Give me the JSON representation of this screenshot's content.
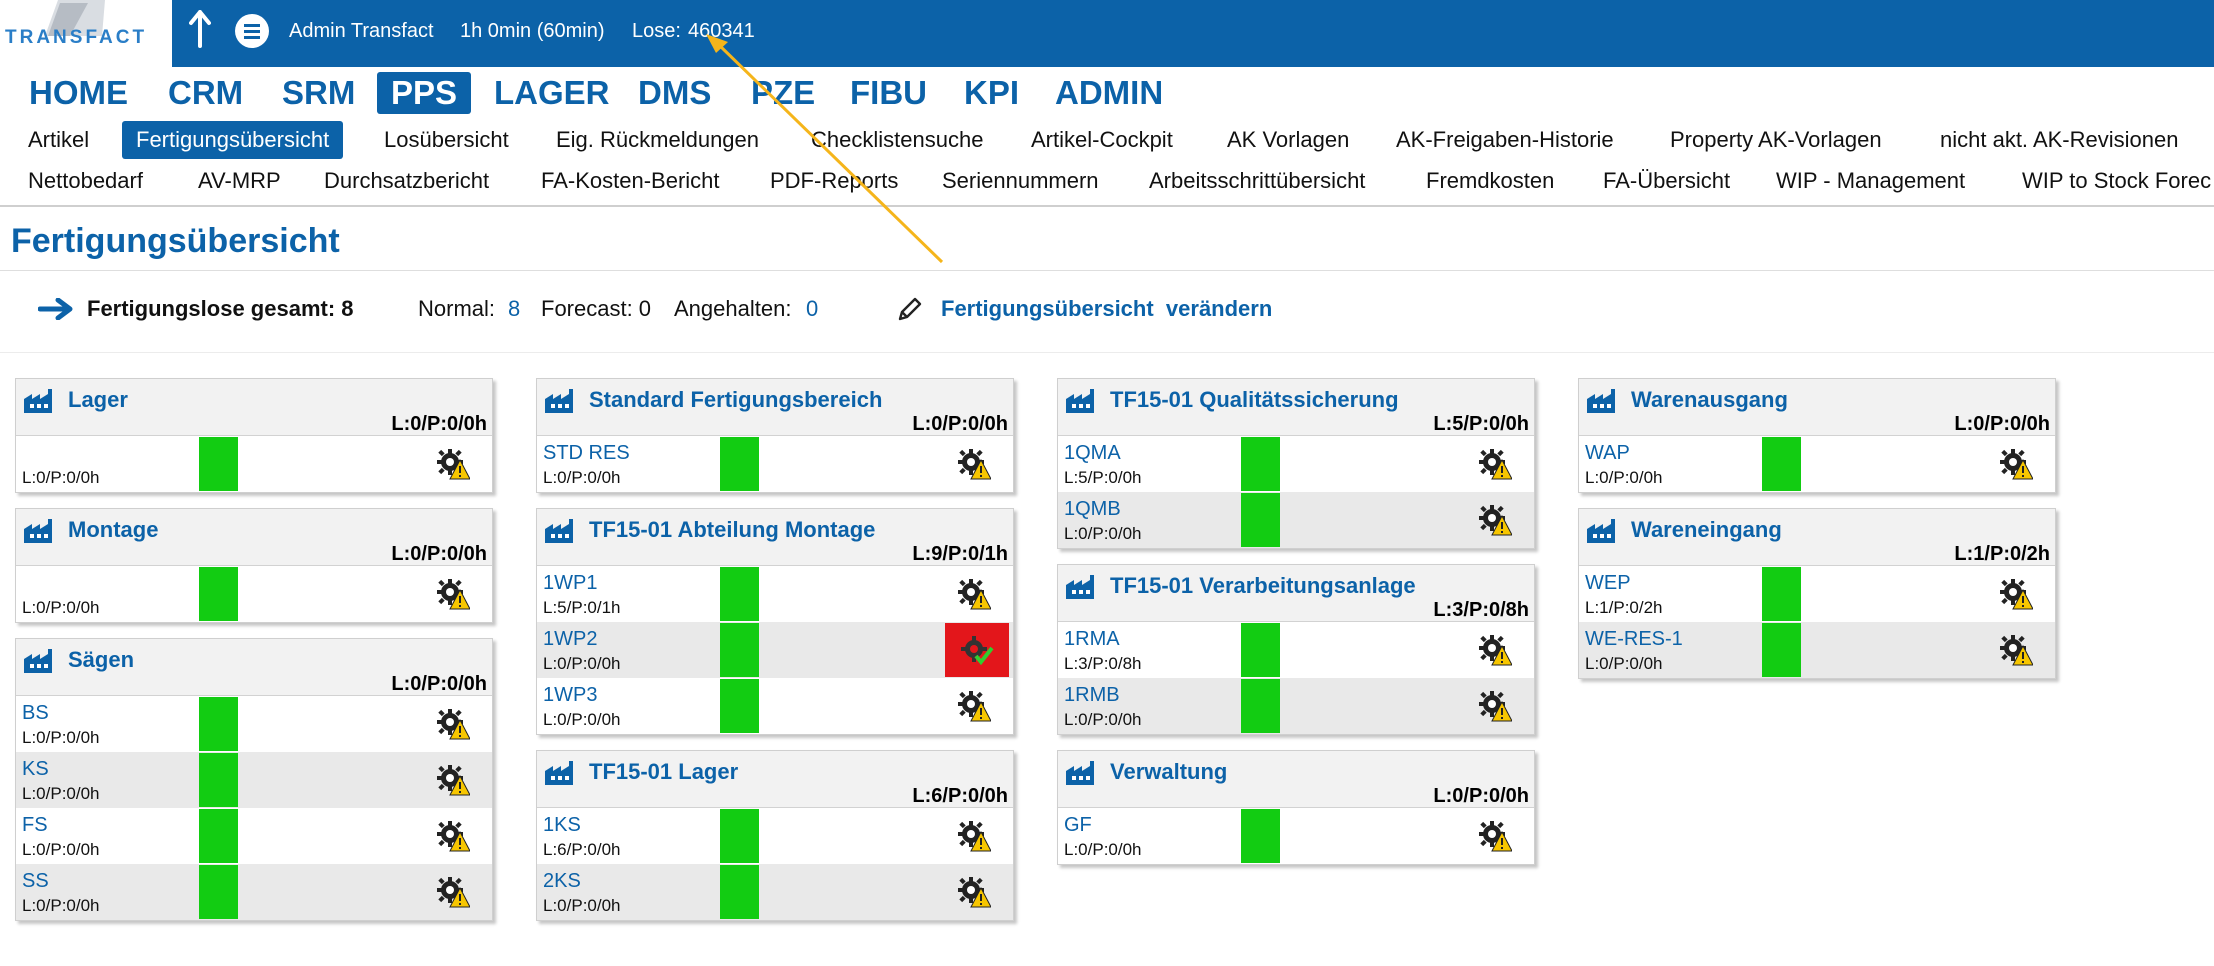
{
  "header": {
    "logo_text": "TRANSFACT",
    "user": "Admin Transfact",
    "session": "1h 0min (60min)",
    "lose_label": "Lose:",
    "lose_value": "460341"
  },
  "main_nav": [
    {
      "label": "HOME",
      "active": false
    },
    {
      "label": "CRM",
      "active": false
    },
    {
      "label": "SRM",
      "active": false
    },
    {
      "label": "PPS",
      "active": true
    },
    {
      "label": "LAGER",
      "active": false
    },
    {
      "label": "DMS",
      "active": false
    },
    {
      "label": "PZE",
      "active": false
    },
    {
      "label": "FIBU",
      "active": false
    },
    {
      "label": "KPI",
      "active": false
    },
    {
      "label": "ADMIN",
      "active": false
    }
  ],
  "sub_nav_row1": [
    {
      "label": "Artikel"
    },
    {
      "label": "Fertigungsübersicht",
      "active": true
    },
    {
      "label": "Losübersicht"
    },
    {
      "label": "Eig. Rückmeldungen"
    },
    {
      "label": "Checklistensuche"
    },
    {
      "label": "Artikel-Cockpit"
    },
    {
      "label": "AK Vorlagen"
    },
    {
      "label": "AK-Freigaben-Historie"
    },
    {
      "label": "Property AK-Vorlagen"
    },
    {
      "label": "nicht akt. AK-Revisionen"
    }
  ],
  "sub_nav_row2": [
    {
      "label": "Nettobedarf"
    },
    {
      "label": "AV-MRP"
    },
    {
      "label": "Durchsatzbericht"
    },
    {
      "label": "FA-Kosten-Bericht"
    },
    {
      "label": "PDF-Reports"
    },
    {
      "label": "Seriennummern"
    },
    {
      "label": "Arbeitsschrittübersicht"
    },
    {
      "label": "Fremdkosten"
    },
    {
      "label": "FA-Übersicht"
    },
    {
      "label": "WIP - Management"
    },
    {
      "label": "WIP to Stock Forec"
    }
  ],
  "page": {
    "title": "Fertigungsübersicht",
    "summary_label": "Fertigungslose gesamt: 8",
    "normal_label": "Normal:",
    "normal_value": "8",
    "forecast_label": "Forecast: 0",
    "angehalten_label": "Angehalten:",
    "angehalten_value": "0",
    "edit_link": "Fertigungsübersicht  verändern"
  },
  "columns": [
    [
      {
        "title": "Lager",
        "total": "L:0/P:0/0h",
        "rows": [
          {
            "name": "",
            "stat": "L:0/P:0/0h",
            "alert": false
          }
        ]
      },
      {
        "title": "Montage",
        "total": "L:0/P:0/0h",
        "rows": [
          {
            "name": "",
            "stat": "L:0/P:0/0h",
            "alert": false
          }
        ]
      },
      {
        "title": "Sägen",
        "total": "L:0/P:0/0h",
        "rows": [
          {
            "name": "BS",
            "stat": "L:0/P:0/0h",
            "alert": false
          },
          {
            "name": "KS",
            "stat": "L:0/P:0/0h",
            "alert": false
          },
          {
            "name": "FS",
            "stat": "L:0/P:0/0h",
            "alert": false
          },
          {
            "name": "SS",
            "stat": "L:0/P:0/0h",
            "alert": false
          }
        ]
      }
    ],
    [
      {
        "title": "Standard Fertigungsbereich",
        "total": "L:0/P:0/0h",
        "rows": [
          {
            "name": "STD RES",
            "stat": "L:0/P:0/0h",
            "alert": false
          }
        ]
      },
      {
        "title": "TF15-01 Abteilung Montage",
        "total": "L:9/P:0/1h",
        "rows": [
          {
            "name": "1WP1",
            "stat": "L:5/P:0/1h",
            "alert": false
          },
          {
            "name": "1WP2",
            "stat": "L:0/P:0/0h",
            "alert": true
          },
          {
            "name": "1WP3",
            "stat": "L:0/P:0/0h",
            "alert": false
          }
        ]
      },
      {
        "title": "TF15-01 Lager",
        "total": "L:6/P:0/0h",
        "rows": [
          {
            "name": "1KS",
            "stat": "L:6/P:0/0h",
            "alert": false
          },
          {
            "name": "2KS",
            "stat": "L:0/P:0/0h",
            "alert": false
          }
        ]
      }
    ],
    [
      {
        "title": "TF15-01 Qualitätssicherung",
        "total": "L:5/P:0/0h",
        "rows": [
          {
            "name": "1QMA",
            "stat": "L:5/P:0/0h",
            "alert": false
          },
          {
            "name": "1QMB",
            "stat": "L:0/P:0/0h",
            "alert": false
          }
        ]
      },
      {
        "title": "TF15-01 Verarbeitungsanlage",
        "total": "L:3/P:0/8h",
        "rows": [
          {
            "name": "1RMA",
            "stat": "L:3/P:0/8h",
            "alert": false
          },
          {
            "name": "1RMB",
            "stat": "L:0/P:0/0h",
            "alert": false
          }
        ]
      },
      {
        "title": "Verwaltung",
        "total": "L:0/P:0/0h",
        "rows": [
          {
            "name": "GF",
            "stat": "L:0/P:0/0h",
            "alert": false
          }
        ]
      }
    ],
    [
      {
        "title": "Warenausgang",
        "total": "L:0/P:0/0h",
        "rows": [
          {
            "name": "WAP",
            "stat": "L:0/P:0/0h",
            "alert": false
          }
        ]
      },
      {
        "title": "Wareneingang",
        "total": "L:1/P:0/2h",
        "rows": [
          {
            "name": "WEP",
            "stat": "L:1/P:0/2h",
            "alert": false
          },
          {
            "name": "WE-RES-1",
            "stat": "L:0/P:0/0h",
            "alert": false
          }
        ]
      }
    ]
  ],
  "colors": {
    "brand_blue": "#0c62a8",
    "status_green": "#12cc12",
    "alert_red": "#e3161b",
    "annotation_arrow": "#f5b51b"
  }
}
